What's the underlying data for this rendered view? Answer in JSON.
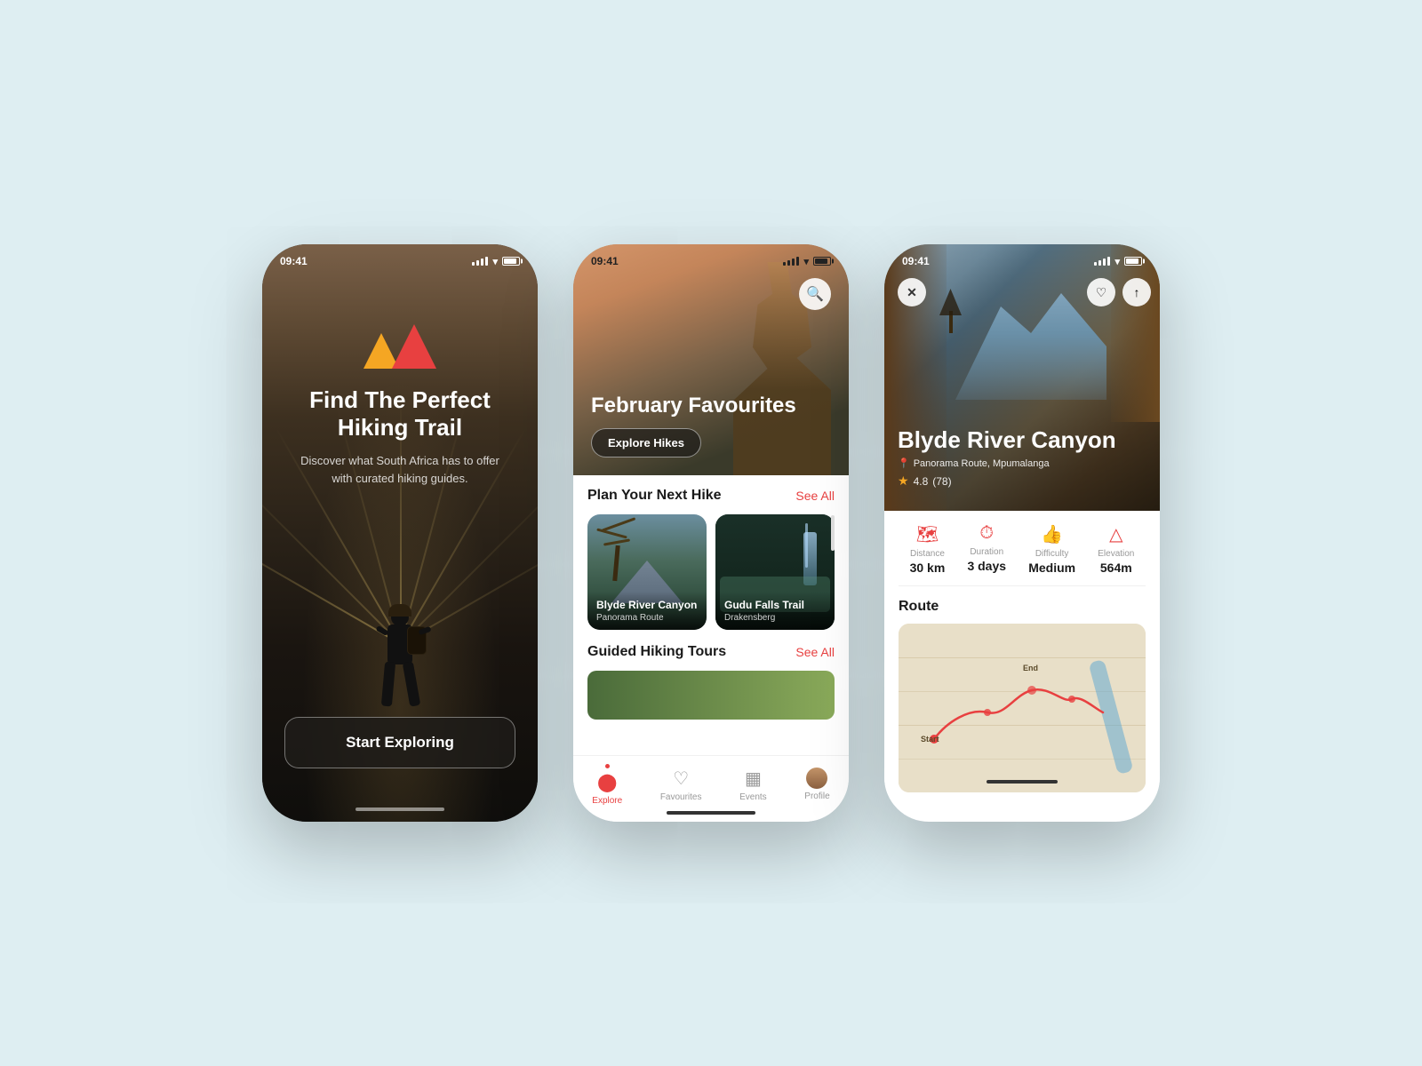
{
  "background": "#deeef2",
  "phone1": {
    "statusBar": {
      "time": "09:41",
      "color": "light"
    },
    "logo": {
      "label": "Hiking App Logo"
    },
    "title": "Find The Perfect Hiking Trail",
    "subtitle": "Discover what South Africa has to offer with curated hiking guides.",
    "cta": "Start Exploring"
  },
  "phone2": {
    "statusBar": {
      "time": "09:41",
      "color": "dark"
    },
    "hero": {
      "title": "February Favourites",
      "cta": "Explore Hikes"
    },
    "sections": [
      {
        "title": "Plan Your Next Hike",
        "seeAll": "See All",
        "cards": [
          {
            "name": "Blyde River Canyon",
            "location": "Panorama Route"
          },
          {
            "name": "Gudu Falls Trail",
            "location": "Drakensberg"
          }
        ]
      },
      {
        "title": "Guided Hiking Tours",
        "seeAll": "See All"
      }
    ],
    "nav": [
      {
        "icon": "🔴",
        "label": "Explore",
        "active": true
      },
      {
        "icon": "♡",
        "label": "Favourites",
        "active": false
      },
      {
        "icon": "📅",
        "label": "Events",
        "active": false
      },
      {
        "icon": "👤",
        "label": "Profile",
        "active": false
      }
    ]
  },
  "phone3": {
    "statusBar": {
      "time": "09:41",
      "color": "light"
    },
    "trail": {
      "name": "Blyde River Canyon",
      "location": "Panorama Route, Mpumalanga",
      "rating": "4.8",
      "reviewCount": "(78)"
    },
    "stats": [
      {
        "icon": "🗺",
        "label": "Distance",
        "value": "30 km"
      },
      {
        "icon": "⏱",
        "label": "Duration",
        "value": "3 days"
      },
      {
        "icon": "👍",
        "label": "Difficulty",
        "value": "Medium"
      },
      {
        "icon": "△",
        "label": "Elevation",
        "value": "564m"
      }
    ],
    "route": {
      "title": "Route",
      "startLabel": "Start",
      "endLabel": "End"
    }
  }
}
